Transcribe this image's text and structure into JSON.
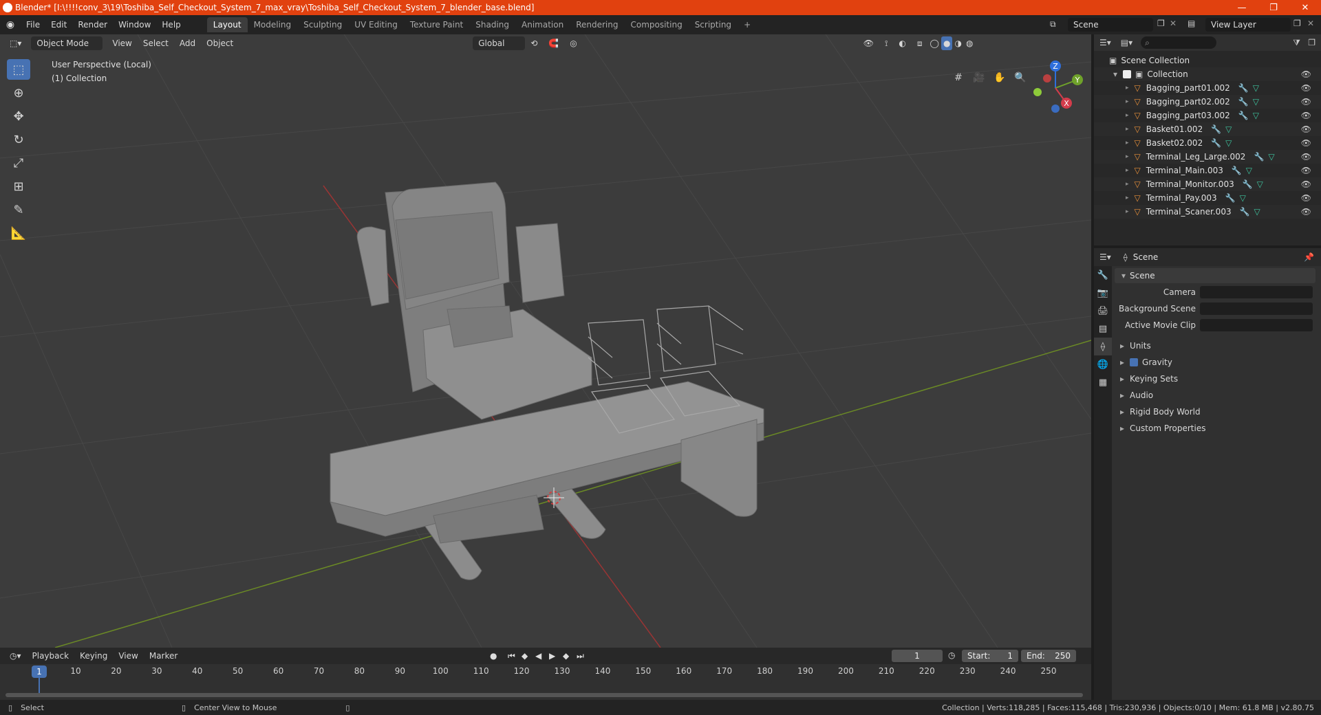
{
  "window": {
    "title": "Blender* [I:\\!!!!conv_3\\19\\Toshiba_Self_Checkout_System_7_max_vray\\Toshiba_Self_Checkout_System_7_blender_base.blend]",
    "minimize": "—",
    "maximize": "❐",
    "close": "✕"
  },
  "menu": [
    "File",
    "Edit",
    "Render",
    "Window",
    "Help"
  ],
  "workspaces": [
    "Layout",
    "Modeling",
    "Sculpting",
    "UV Editing",
    "Texture Paint",
    "Shading",
    "Animation",
    "Rendering",
    "Compositing",
    "Scripting",
    "+"
  ],
  "active_workspace": "Layout",
  "scene_name": "Scene",
  "view_layer": "View Layer",
  "viewport": {
    "mode": "Object Mode",
    "menus": [
      "View",
      "Select",
      "Add",
      "Object"
    ],
    "transform_orientation": "Global",
    "info_line1": "User Perspective (Local)",
    "info_line2": "(1) Collection",
    "gizmo_z": "Z",
    "gizmo_y": "Y",
    "gizmo_x": "X"
  },
  "timeline": {
    "menus": [
      "Playback",
      "Keying",
      "View",
      "Marker"
    ],
    "current_frame": "1",
    "start_label": "Start:",
    "start": "1",
    "end_label": "End:",
    "end": "250",
    "ticks": [
      "1",
      "10",
      "20",
      "30",
      "40",
      "50",
      "60",
      "70",
      "80",
      "90",
      "100",
      "110",
      "120",
      "130",
      "140",
      "150",
      "160",
      "170",
      "180",
      "190",
      "200",
      "210",
      "220",
      "230",
      "240",
      "250"
    ]
  },
  "statusbar": {
    "select": "Select",
    "center_view": "Center View to Mouse",
    "stats": "Collection | Verts:118,285 | Faces:115,468 | Tris:230,936 | Objects:0/10 | Mem: 61.8 MB | v2.80.75"
  },
  "outliner": {
    "root": "Scene Collection",
    "collection": "Collection",
    "objects": [
      "Bagging_part01.002",
      "Bagging_part02.002",
      "Bagging_part03.002",
      "Basket01.002",
      "Basket02.002",
      "Terminal_Leg_Large.002",
      "Terminal_Main.003",
      "Terminal_Monitor.003",
      "Terminal_Pay.003",
      "Terminal_Scaner.003"
    ]
  },
  "properties": {
    "context": "Scene",
    "panel": "Scene",
    "camera_label": "Camera",
    "background_scene_label": "Background Scene",
    "active_movie_clip_label": "Active Movie Clip",
    "sections": [
      "Units",
      "Gravity",
      "Keying Sets",
      "Audio",
      "Rigid Body World",
      "Custom Properties"
    ]
  }
}
